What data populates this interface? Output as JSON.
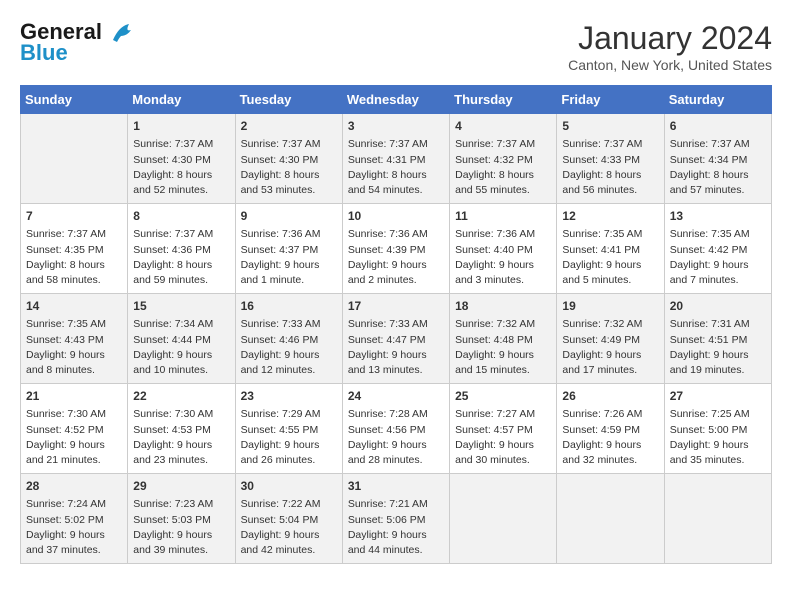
{
  "header": {
    "logo_line1": "General",
    "logo_line2": "Blue",
    "title": "January 2024",
    "subtitle": "Canton, New York, United States"
  },
  "weekdays": [
    "Sunday",
    "Monday",
    "Tuesday",
    "Wednesday",
    "Thursday",
    "Friday",
    "Saturday"
  ],
  "weeks": [
    [
      {
        "day": "",
        "sunrise": "",
        "sunset": "",
        "daylight": ""
      },
      {
        "day": "1",
        "sunrise": "Sunrise: 7:37 AM",
        "sunset": "Sunset: 4:30 PM",
        "daylight": "Daylight: 8 hours and 52 minutes."
      },
      {
        "day": "2",
        "sunrise": "Sunrise: 7:37 AM",
        "sunset": "Sunset: 4:30 PM",
        "daylight": "Daylight: 8 hours and 53 minutes."
      },
      {
        "day": "3",
        "sunrise": "Sunrise: 7:37 AM",
        "sunset": "Sunset: 4:31 PM",
        "daylight": "Daylight: 8 hours and 54 minutes."
      },
      {
        "day": "4",
        "sunrise": "Sunrise: 7:37 AM",
        "sunset": "Sunset: 4:32 PM",
        "daylight": "Daylight: 8 hours and 55 minutes."
      },
      {
        "day": "5",
        "sunrise": "Sunrise: 7:37 AM",
        "sunset": "Sunset: 4:33 PM",
        "daylight": "Daylight: 8 hours and 56 minutes."
      },
      {
        "day": "6",
        "sunrise": "Sunrise: 7:37 AM",
        "sunset": "Sunset: 4:34 PM",
        "daylight": "Daylight: 8 hours and 57 minutes."
      }
    ],
    [
      {
        "day": "7",
        "sunrise": "Sunrise: 7:37 AM",
        "sunset": "Sunset: 4:35 PM",
        "daylight": "Daylight: 8 hours and 58 minutes."
      },
      {
        "day": "8",
        "sunrise": "Sunrise: 7:37 AM",
        "sunset": "Sunset: 4:36 PM",
        "daylight": "Daylight: 8 hours and 59 minutes."
      },
      {
        "day": "9",
        "sunrise": "Sunrise: 7:36 AM",
        "sunset": "Sunset: 4:37 PM",
        "daylight": "Daylight: 9 hours and 1 minute."
      },
      {
        "day": "10",
        "sunrise": "Sunrise: 7:36 AM",
        "sunset": "Sunset: 4:39 PM",
        "daylight": "Daylight: 9 hours and 2 minutes."
      },
      {
        "day": "11",
        "sunrise": "Sunrise: 7:36 AM",
        "sunset": "Sunset: 4:40 PM",
        "daylight": "Daylight: 9 hours and 3 minutes."
      },
      {
        "day": "12",
        "sunrise": "Sunrise: 7:35 AM",
        "sunset": "Sunset: 4:41 PM",
        "daylight": "Daylight: 9 hours and 5 minutes."
      },
      {
        "day": "13",
        "sunrise": "Sunrise: 7:35 AM",
        "sunset": "Sunset: 4:42 PM",
        "daylight": "Daylight: 9 hours and 7 minutes."
      }
    ],
    [
      {
        "day": "14",
        "sunrise": "Sunrise: 7:35 AM",
        "sunset": "Sunset: 4:43 PM",
        "daylight": "Daylight: 9 hours and 8 minutes."
      },
      {
        "day": "15",
        "sunrise": "Sunrise: 7:34 AM",
        "sunset": "Sunset: 4:44 PM",
        "daylight": "Daylight: 9 hours and 10 minutes."
      },
      {
        "day": "16",
        "sunrise": "Sunrise: 7:33 AM",
        "sunset": "Sunset: 4:46 PM",
        "daylight": "Daylight: 9 hours and 12 minutes."
      },
      {
        "day": "17",
        "sunrise": "Sunrise: 7:33 AM",
        "sunset": "Sunset: 4:47 PM",
        "daylight": "Daylight: 9 hours and 13 minutes."
      },
      {
        "day": "18",
        "sunrise": "Sunrise: 7:32 AM",
        "sunset": "Sunset: 4:48 PM",
        "daylight": "Daylight: 9 hours and 15 minutes."
      },
      {
        "day": "19",
        "sunrise": "Sunrise: 7:32 AM",
        "sunset": "Sunset: 4:49 PM",
        "daylight": "Daylight: 9 hours and 17 minutes."
      },
      {
        "day": "20",
        "sunrise": "Sunrise: 7:31 AM",
        "sunset": "Sunset: 4:51 PM",
        "daylight": "Daylight: 9 hours and 19 minutes."
      }
    ],
    [
      {
        "day": "21",
        "sunrise": "Sunrise: 7:30 AM",
        "sunset": "Sunset: 4:52 PM",
        "daylight": "Daylight: 9 hours and 21 minutes."
      },
      {
        "day": "22",
        "sunrise": "Sunrise: 7:30 AM",
        "sunset": "Sunset: 4:53 PM",
        "daylight": "Daylight: 9 hours and 23 minutes."
      },
      {
        "day": "23",
        "sunrise": "Sunrise: 7:29 AM",
        "sunset": "Sunset: 4:55 PM",
        "daylight": "Daylight: 9 hours and 26 minutes."
      },
      {
        "day": "24",
        "sunrise": "Sunrise: 7:28 AM",
        "sunset": "Sunset: 4:56 PM",
        "daylight": "Daylight: 9 hours and 28 minutes."
      },
      {
        "day": "25",
        "sunrise": "Sunrise: 7:27 AM",
        "sunset": "Sunset: 4:57 PM",
        "daylight": "Daylight: 9 hours and 30 minutes."
      },
      {
        "day": "26",
        "sunrise": "Sunrise: 7:26 AM",
        "sunset": "Sunset: 4:59 PM",
        "daylight": "Daylight: 9 hours and 32 minutes."
      },
      {
        "day": "27",
        "sunrise": "Sunrise: 7:25 AM",
        "sunset": "Sunset: 5:00 PM",
        "daylight": "Daylight: 9 hours and 35 minutes."
      }
    ],
    [
      {
        "day": "28",
        "sunrise": "Sunrise: 7:24 AM",
        "sunset": "Sunset: 5:02 PM",
        "daylight": "Daylight: 9 hours and 37 minutes."
      },
      {
        "day": "29",
        "sunrise": "Sunrise: 7:23 AM",
        "sunset": "Sunset: 5:03 PM",
        "daylight": "Daylight: 9 hours and 39 minutes."
      },
      {
        "day": "30",
        "sunrise": "Sunrise: 7:22 AM",
        "sunset": "Sunset: 5:04 PM",
        "daylight": "Daylight: 9 hours and 42 minutes."
      },
      {
        "day": "31",
        "sunrise": "Sunrise: 7:21 AM",
        "sunset": "Sunset: 5:06 PM",
        "daylight": "Daylight: 9 hours and 44 minutes."
      },
      {
        "day": "",
        "sunrise": "",
        "sunset": "",
        "daylight": ""
      },
      {
        "day": "",
        "sunrise": "",
        "sunset": "",
        "daylight": ""
      },
      {
        "day": "",
        "sunrise": "",
        "sunset": "",
        "daylight": ""
      }
    ]
  ]
}
